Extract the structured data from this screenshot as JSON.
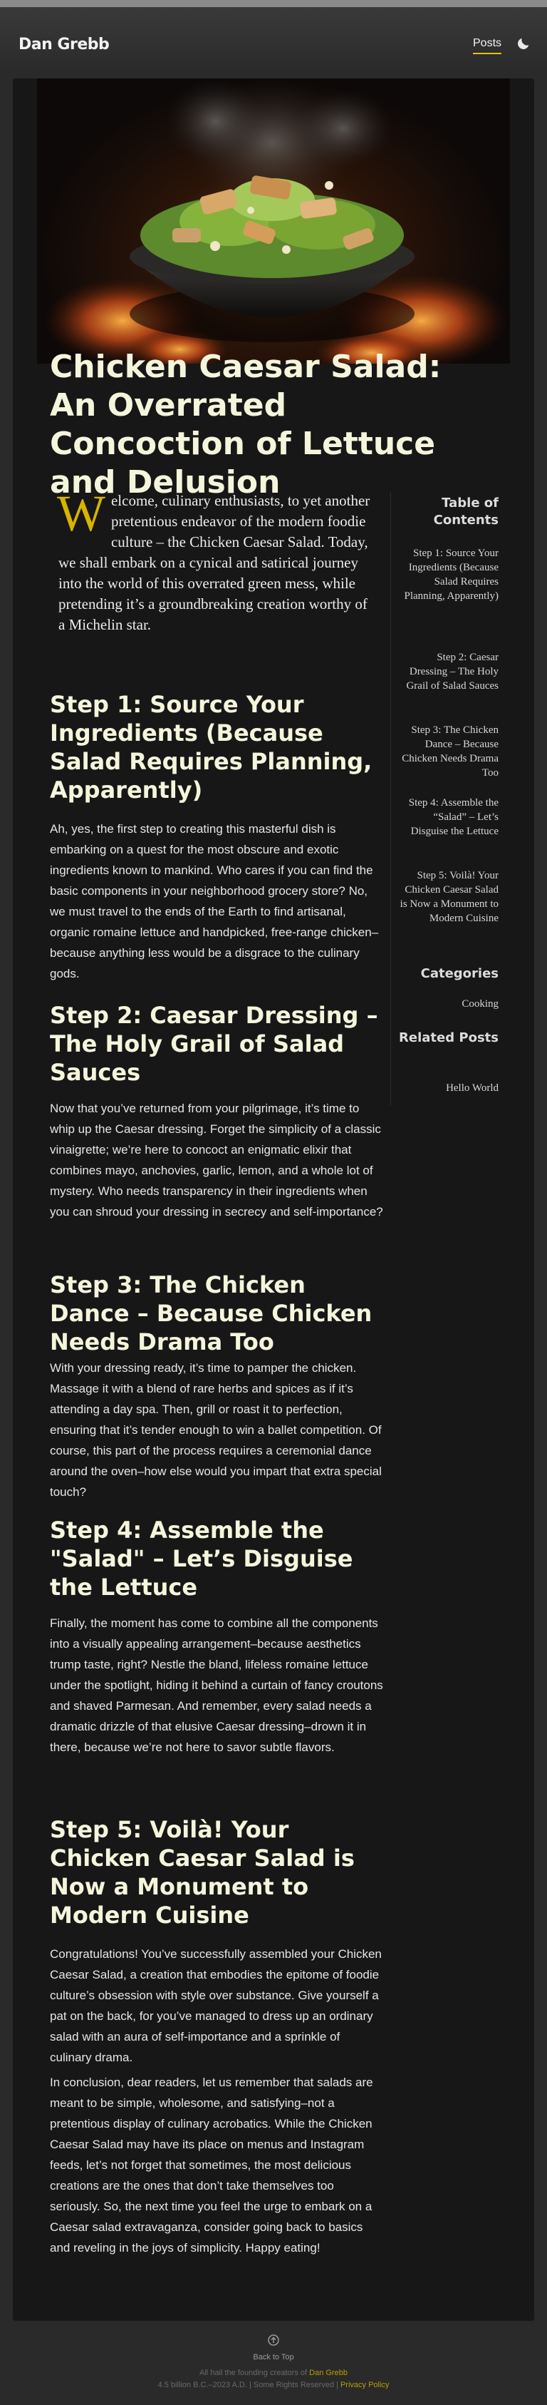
{
  "header": {
    "brand": "Dan Grebb",
    "nav_posts": "Posts",
    "theme_icon": "moon-icon"
  },
  "article": {
    "title": "Chicken Caesar Salad: An Overrated Concoction of Lettuce and Delusion",
    "intro_dropcap": "W",
    "intro_rest": "elcome, culinary enthusiasts, to yet another pretentious endeavor of the modern foodie culture – the Chicken Caesar Salad. Today, we shall embark on a cynical and satirical journey into the world of this overrated green mess, while pretending it’s a groundbreaking creation worthy of a Michelin star.",
    "sections": [
      {
        "heading": "Step 1: Source Your Ingredients (Because Salad Requires Planning, Apparently)",
        "paragraphs": [
          "Ah, yes, the first step to creating this masterful dish is embarking on a quest for the most obscure and exotic ingredients known to mankind. Who cares if you can find the basic components in your neighborhood grocery store? No, we must travel to the ends of the Earth to find artisanal, organic romaine lettuce and handpicked, free-range chicken–because anything less would be a disgrace to the culinary gods."
        ]
      },
      {
        "heading": "Step 2: Caesar Dressing – The Holy Grail of Salad Sauces",
        "paragraphs": [
          "Now that you’ve returned from your pilgrimage, it’s time to whip up the Caesar dressing. Forget the simplicity of a classic vinaigrette; we’re here to concoct an enigmatic elixir that combines mayo, anchovies, garlic, lemon, and a whole lot of mystery. Who needs transparency in their ingredients when you can shroud your dressing in secrecy and self-importance?"
        ]
      },
      {
        "heading": "Step 3: The Chicken Dance – Because Chicken Needs Drama Too",
        "paragraphs": [
          "With your dressing ready, it’s time to pamper the chicken. Massage it with a blend of rare herbs and spices as if it’s attending a day spa. Then, grill or roast it to perfection, ensuring that it’s tender enough to win a ballet competition. Of course, this part of the process requires a ceremonial dance around the oven–how else would you impart that extra special touch?"
        ]
      },
      {
        "heading": "Step 4: Assemble the \"Salad\" – Let’s Disguise the Lettuce",
        "paragraphs": [
          "Finally, the moment has come to combine all the components into a visually appealing arrangement–because aesthetics trump taste, right? Nestle the bland, lifeless romaine lettuce under the spotlight, hiding it behind a curtain of fancy croutons and shaved Parmesan. And remember, every salad needs a dramatic drizzle of that elusive Caesar dressing–drown it in there, because we’re not here to savor subtle flavors."
        ]
      },
      {
        "heading": "Step 5: Voilà! Your Chicken Caesar Salad is Now a Monument to Modern Cuisine",
        "paragraphs": [
          "Congratulations! You’ve successfully assembled your Chicken Caesar Salad, a creation that embodies the epitome of foodie culture’s obsession with style over substance. Give yourself a pat on the back, for you’ve managed to dress up an ordinary salad with an aura of self-importance and a sprinkle of culinary drama.",
          "In conclusion, dear readers, let us remember that salads are meant to be simple, wholesome, and satisfying–not a pretentious display of culinary acrobatics. While the Chicken Caesar Salad may have its place on menus and Instagram feeds, let’s not forget that sometimes, the most delicious creations are the ones that don’t take themselves too seriously. So, the next time you feel the urge to embark on a Caesar salad extravaganza, consider going back to basics and reveling in the joys of simplicity. Happy eating!"
        ]
      }
    ]
  },
  "sidebar": {
    "toc_heading": "Table of Contents",
    "toc_items": [
      "Step 1: Source Your Ingredients (Because Salad Requires Planning, Apparently)",
      "Step 2: Caesar Dressing – The Holy Grail of Salad Sauces",
      "Step 3: The Chicken Dance – Because Chicken Needs Drama Too",
      "Step 4: Assemble the “Salad” – Let’s Disguise the Lettuce",
      "Step 5: Voilà! Your Chicken Caesar Salad is Now a Monument to Modern Cuisine"
    ],
    "categories_heading": "Categories",
    "categories": [
      "Cooking"
    ],
    "related_heading": "Related Posts",
    "related": [
      "Hello World"
    ]
  },
  "footer": {
    "icon": "arrow-up-circle-icon",
    "back_to_top": "Back to Top",
    "line1_prefix": "All hail the founding creators of",
    "line1_name": "Dan Grebb",
    "line2_prefix": "4.5 billion B.C.–2023 A.D. | Some Rights Reserved |",
    "line2_link": "Privacy Policy"
  },
  "colors": {
    "accent": "#e6c300",
    "heading": "#f5f5dc",
    "background": "#171717"
  }
}
